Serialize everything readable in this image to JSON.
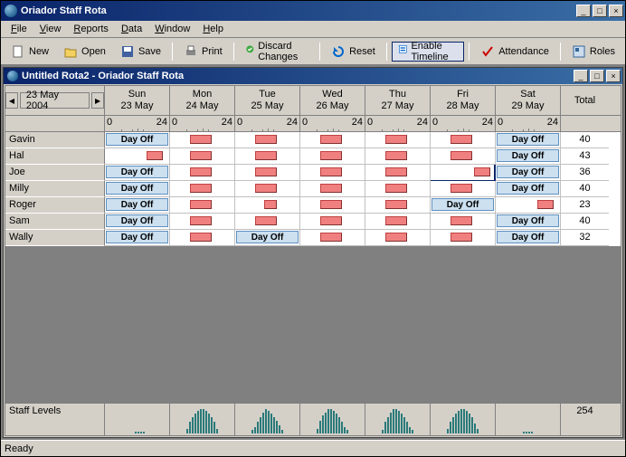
{
  "window": {
    "title": "Oriador Staff Rota",
    "min": "_",
    "max": "□",
    "close": "×"
  },
  "menu": [
    "File",
    "View",
    "Reports",
    "Data",
    "Window",
    "Help"
  ],
  "toolbar": [
    {
      "id": "new",
      "label": "New"
    },
    {
      "id": "open",
      "label": "Open"
    },
    {
      "id": "save",
      "label": "Save"
    },
    {
      "sep": true
    },
    {
      "id": "print",
      "label": "Print"
    },
    {
      "sep": true
    },
    {
      "id": "discard",
      "label": "Discard Changes"
    },
    {
      "sep": true
    },
    {
      "id": "reset",
      "label": "Reset"
    },
    {
      "sep": true
    },
    {
      "id": "timeline",
      "label": "Enable Timeline",
      "active": true
    },
    {
      "sep": true
    },
    {
      "id": "attendance",
      "label": "Attendance"
    },
    {
      "sep": true
    },
    {
      "id": "roles",
      "label": "Roles"
    }
  ],
  "child_title": "Untitled Rota2 - Oriador Staff Rota",
  "current_date": "23 May 2004",
  "days": [
    {
      "dow": "Sun",
      "date": "23 May"
    },
    {
      "dow": "Mon",
      "date": "24 May"
    },
    {
      "dow": "Tue",
      "date": "25 May"
    },
    {
      "dow": "Wed",
      "date": "26 May"
    },
    {
      "dow": "Thu",
      "date": "27 May"
    },
    {
      "dow": "Fri",
      "date": "28 May"
    },
    {
      "dow": "Sat",
      "date": "29 May"
    }
  ],
  "total_label": "Total",
  "time_start": "0",
  "time_end": "24",
  "staff": [
    {
      "name": "Gavin",
      "cells": [
        "off",
        "s",
        "s",
        "s",
        "s",
        "s",
        "off"
      ],
      "total": 40
    },
    {
      "name": "Hal",
      "cells": [
        "sr",
        "s",
        "s",
        "s",
        "s",
        "s",
        "off"
      ],
      "total": 43
    },
    {
      "name": "Joe",
      "cells": [
        "off",
        "s",
        "s",
        "s",
        "s",
        "sr2",
        "off"
      ],
      "total": 36
    },
    {
      "name": "Milly",
      "cells": [
        "off",
        "s",
        "s",
        "s",
        "s",
        "s",
        "off"
      ],
      "total": 40
    },
    {
      "name": "Roger",
      "cells": [
        "off",
        "s",
        "sm",
        "s",
        "s",
        "off",
        "sr"
      ],
      "total": 23
    },
    {
      "name": "Sam",
      "cells": [
        "off",
        "s",
        "s",
        "s",
        "s",
        "s",
        "off"
      ],
      "total": 40
    },
    {
      "name": "Wally",
      "cells": [
        "off",
        "s",
        "off",
        "s",
        "s",
        "s",
        "off"
      ],
      "total": 32
    }
  ],
  "dayoff_label": "Day Off",
  "staff_levels_label": "Staff Levels",
  "staff_levels_total": 254,
  "levels": [
    [
      0,
      0,
      0,
      0,
      0,
      1,
      1,
      1,
      1,
      0,
      0,
      0
    ],
    [
      3,
      7,
      10,
      12,
      14,
      15,
      15,
      14,
      12,
      10,
      7,
      3
    ],
    [
      2,
      4,
      7,
      10,
      13,
      15,
      14,
      12,
      10,
      8,
      5,
      2
    ],
    [
      3,
      8,
      11,
      13,
      15,
      15,
      14,
      12,
      10,
      7,
      4,
      2
    ],
    [
      2,
      7,
      10,
      13,
      15,
      15,
      14,
      12,
      10,
      7,
      4,
      2
    ],
    [
      3,
      7,
      10,
      12,
      14,
      15,
      15,
      14,
      12,
      10,
      6,
      3
    ],
    [
      0,
      0,
      0,
      0,
      1,
      1,
      1,
      1,
      0,
      0,
      0,
      0
    ]
  ],
  "status": "Ready"
}
